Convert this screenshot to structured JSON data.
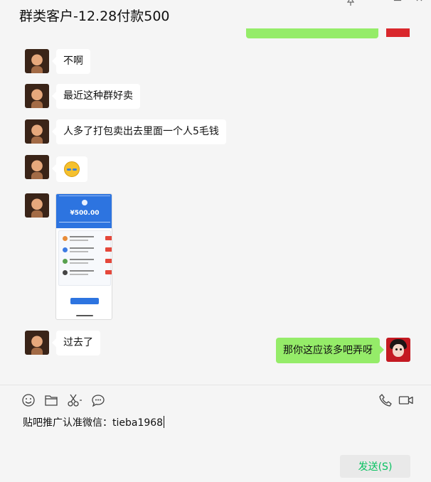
{
  "window": {
    "title": "群类客户-12.28付款500"
  },
  "messages": [
    {
      "side": "left",
      "type": "text",
      "text": "不啊"
    },
    {
      "side": "left",
      "type": "text",
      "text": "最近这种群好卖"
    },
    {
      "side": "left",
      "type": "text",
      "text": "人多了打包卖出去里面一个人5毛钱"
    },
    {
      "side": "left",
      "type": "emoji",
      "icon": "laugh-cry-emoji-icon"
    },
    {
      "side": "left",
      "type": "image",
      "amount": "¥500.00"
    },
    {
      "side": "left",
      "type": "text",
      "text": "过去了"
    },
    {
      "side": "right",
      "type": "text",
      "text": "那你这应该多吧弄呀"
    }
  ],
  "toolbar": {
    "icons": [
      "emoji-icon",
      "folder-icon",
      "scissors-icon",
      "chat-bubble-icon",
      "phone-icon",
      "video-icon"
    ]
  },
  "input": {
    "value": "贴吧推广认准微信：tieba1968"
  },
  "send_button": {
    "label": "发送(S)"
  },
  "colors": {
    "outgoing_bubble": "#95ec69",
    "incoming_bubble": "#ffffff",
    "send_text": "#07c160",
    "background": "#f5f5f5"
  }
}
